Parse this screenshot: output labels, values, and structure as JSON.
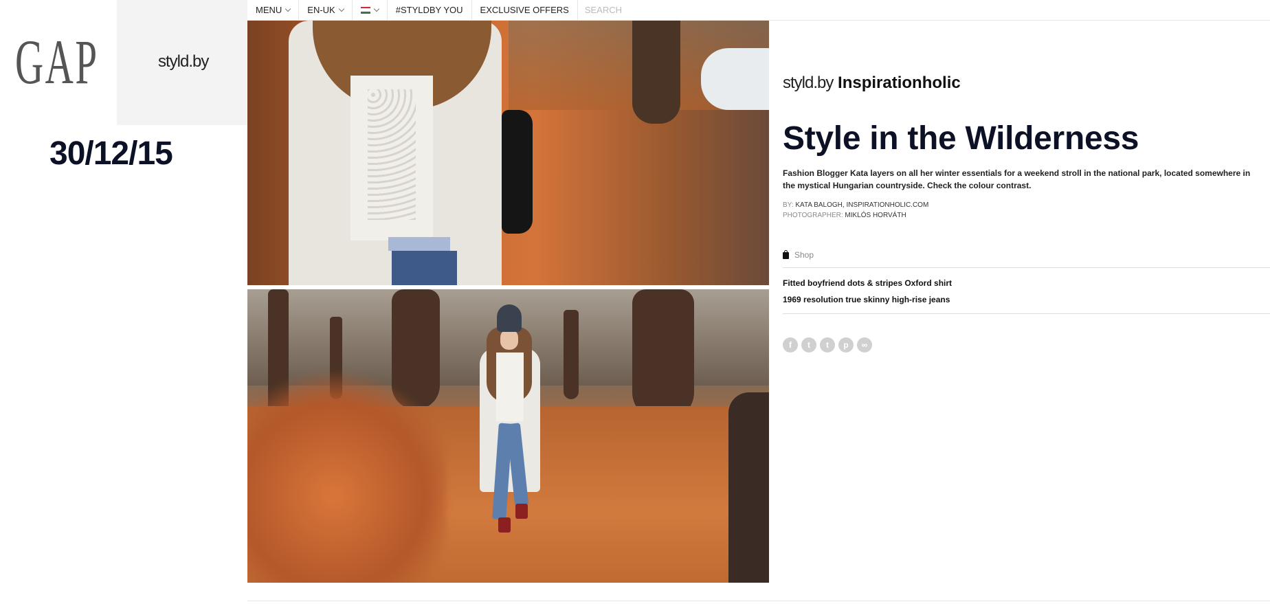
{
  "brand": {
    "logo": "GAP",
    "channel": "styld.by",
    "date": "30/12/15"
  },
  "nav": {
    "menu": "MENU",
    "language": "EN-UK",
    "flag_colors": [
      "#cd2a3e",
      "#ffffff",
      "#436f4d"
    ],
    "styldby": "#STYLDBY YOU",
    "offers": "EXCLUSIVE OFFERS",
    "search_placeholder": "SEARCH"
  },
  "article": {
    "byline_prefix": "styld.by",
    "byline_name": "Inspirationholic",
    "title": "Style in the Wilderness",
    "description": "Fashion Blogger Kata layers on all her winter essentials for a weekend stroll in the national park, located somewhere in the mystical Hungarian countryside. Check the colour contrast.",
    "author_label": "BY:",
    "author": "KATA BALOGH, INSPIRATIONHOLIC.COM",
    "photographer_label": "PHOTOGRAPHER:",
    "photographer": "MIKLÓS HORVÁTH"
  },
  "shop": {
    "label": "Shop",
    "icon": "shopping-bag-icon",
    "products": [
      "Fitted boyfriend dots & stripes Oxford shirt",
      "1969 resolution true skinny high-rise jeans"
    ]
  },
  "social": {
    "facebook": "f",
    "twitter": "t",
    "tumblr": "t",
    "pinterest": "p",
    "link": "∞"
  }
}
